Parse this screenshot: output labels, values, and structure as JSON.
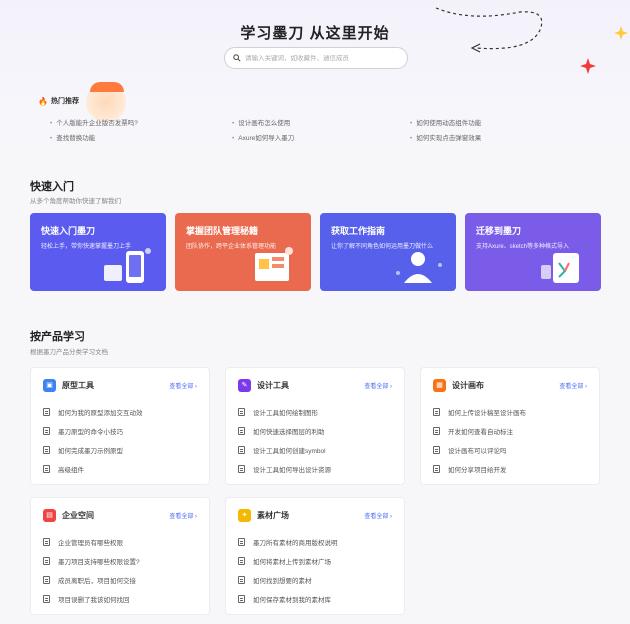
{
  "hero": {
    "title": "学习墨刀  从这里开始",
    "search_placeholder": "请输入关键词，如收藏件、通信成员"
  },
  "hot": {
    "label": "热门推荐",
    "items": [
      "个人版能升企业版否发票吗?",
      "设计画布怎么使用",
      "如何使用动态组件功能",
      "查找替换功能",
      "Axure如何导入墨刀",
      "如何实现点击弹窗效果"
    ]
  },
  "quick": {
    "title": "快速入门",
    "subtitle": "从多个角度帮助你快速了解我们",
    "cards": [
      {
        "title": "快速入门墨刀",
        "subtitle": "轻松上手，带你快速掌握墨刀上手",
        "color": "#5b5bef"
      },
      {
        "title": "掌握团队管理秘籍",
        "subtitle": "团队协作，跨平企业体系管理功能",
        "color": "#ea6a4f"
      },
      {
        "title": "获取工作指南",
        "subtitle": "让你了解不同角色如何运用墨刀做什么",
        "color": "#5660ea"
      },
      {
        "title": "迁移到墨刀",
        "subtitle": "支持Axure、sketch等多种格式导入",
        "color": "#7a5ce8"
      }
    ]
  },
  "product": {
    "title": "按产品学习",
    "subtitle": "根据墨刀产品分类学习文档",
    "more_label": "查看全部",
    "cards": [
      {
        "title": "原型工具",
        "icon_color": "#3b82f6",
        "items": [
          "如何为我的原型添加交互动效",
          "墨刀原型的命令小技巧",
          "如何完成墨刀示例原型",
          "高级组件"
        ]
      },
      {
        "title": "设计工具",
        "icon_color": "#7c3aed",
        "items": [
          "设计工具如何绘制图形",
          "如何快速选择图层的利助",
          "设计工具如何创建symbol",
          "设计工具如何导出设计资源"
        ]
      },
      {
        "title": "设计画布",
        "icon_color": "#f97316",
        "items": [
          "如何上传设计稿至设计画布",
          "开发如何查看自动标注",
          "设计画布可以评论吗",
          "如何分享项目给开发"
        ]
      },
      {
        "title": "企业空间",
        "icon_color": "#ef4444",
        "items": [
          "企业管理员有哪些权限",
          "墨刀项目支持哪些权限设置?",
          "成员离职后，项目如何交接",
          "项目误删了我该如何找回"
        ]
      },
      {
        "title": "素材广场",
        "icon_color": "#f5b800",
        "items": [
          "墨刀所有素材的商用版权说明",
          "如何将素材上传到素材广场",
          "如何找到想要的素材",
          "如何保存素材到我的素材库"
        ]
      }
    ]
  }
}
